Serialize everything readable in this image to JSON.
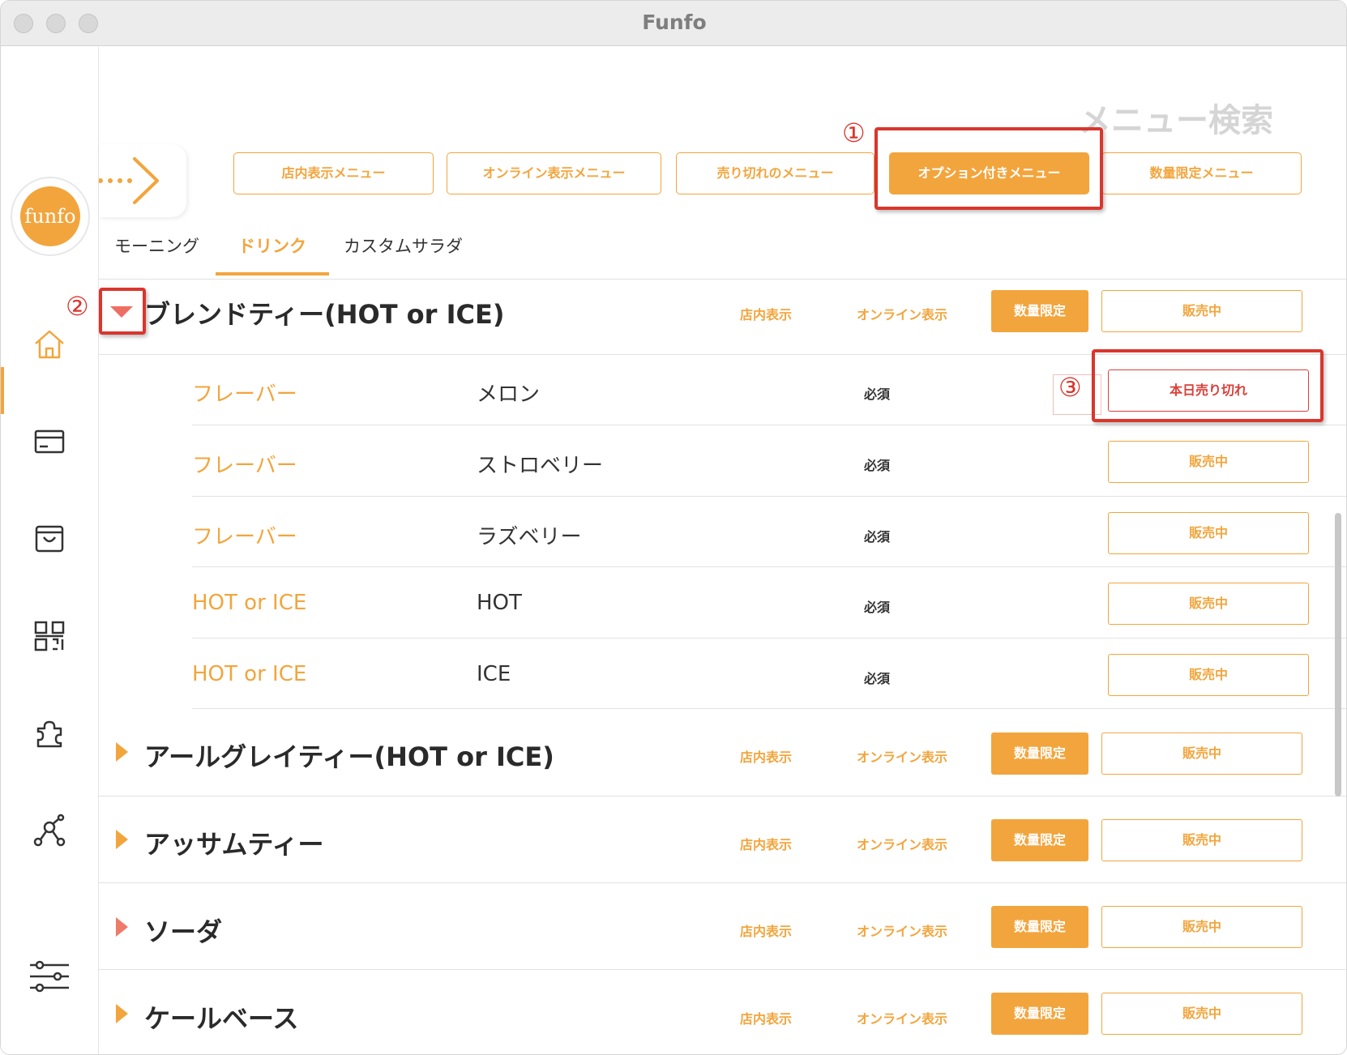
{
  "window": {
    "title": "Funfo"
  },
  "sidebar": {
    "logo_text": "funfo"
  },
  "header": {
    "page_title": "メニュー検索"
  },
  "filters": [
    {
      "label": "店内表示メニュー"
    },
    {
      "label": "オンライン表示メニュー"
    },
    {
      "label": "売り切れのメニュー"
    },
    {
      "label": "オプション付きメニュー",
      "active": true
    },
    {
      "label": "数量限定メニュー"
    }
  ],
  "tabs": [
    {
      "label": "モーニング"
    },
    {
      "label": "ドリンク",
      "active": true
    },
    {
      "label": "カスタムサラダ"
    }
  ],
  "row_labels": {
    "in_store": "店内表示",
    "online": "オンライン表示",
    "qty_limited": "数量限定",
    "on_sale": "販売中",
    "required": "必須",
    "sold_out_today": "本日売り切れ"
  },
  "categories": [
    {
      "name": "ブレンドティー(HOT or ICE)",
      "expanded": true
    },
    {
      "name": "アールグレイティー(HOT or ICE)"
    },
    {
      "name": "アッサムティー"
    },
    {
      "name": "ソーダ"
    },
    {
      "name": "ケールベース"
    }
  ],
  "options": [
    {
      "name": "フレーバー",
      "value": "メロン",
      "status": "本日売り切れ"
    },
    {
      "name": "フレーバー",
      "value": "ストロベリー",
      "status": "販売中"
    },
    {
      "name": "フレーバー",
      "value": "ラズベリー",
      "status": "販売中"
    },
    {
      "name": "HOT or ICE",
      "value": "HOT",
      "status": "販売中"
    },
    {
      "name": "HOT or ICE",
      "value": "ICE",
      "status": "販売中"
    }
  ],
  "annotations": [
    "①",
    "②",
    "③"
  ],
  "colors": {
    "accent": "#f2a53d",
    "annotation": "#d9362d",
    "sold_out": "#d9403a"
  }
}
